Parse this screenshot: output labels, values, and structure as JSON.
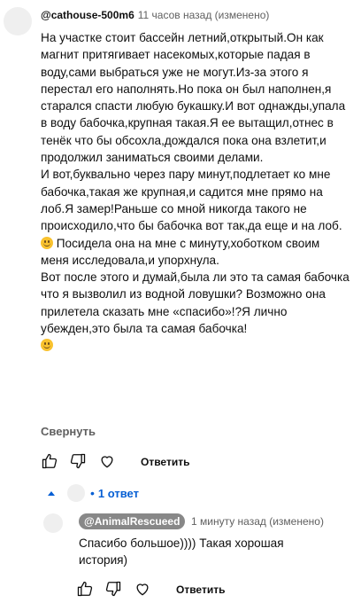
{
  "comment": {
    "author": "@cathouse-500m6",
    "meta": "11 часов назад (изменено)",
    "paragraphs": [
      "На участке стоит бассейн летний,открытый.Он как магнит притягивает насекомых,которые падая в воду,сами выбраться уже не могут.Из-за этого я перестал его наполнять.Но пока он был наполнен,я старался спасти любую букашку.И вот однажды,упала в воду бабочка,крупная такая.Я ее вытащил,отнес в тенёк что бы обсохла,дождался пока она взлетит,и продолжил заниматься своими делами.",
      "И вот,буквально через пару минут,подлетает ко мне бабочка,такая же крупная,и садится мне прямо на лоб.Я замер!Раньше со мной никогда такого не происходило,что бы бабочка вот так,да еще и на лоб.",
      " Посидела она на мне с минуту,хоботком своим меня исследовала,и упорхнула.",
      "Вот после этого и думай,была ли это та самая бабочка что я вызволил из водной ловушки? Возможно она прилетела сказать мне «спасибо»!?Я лично убежден,это была та самая бабочка!"
    ],
    "emoji": "smiling-face-emoji",
    "collapse_label": "Свернуть",
    "reply_label": "Ответить"
  },
  "replies_toggle": {
    "dot": "•",
    "count_label": "1 ответ"
  },
  "reply": {
    "author": "@AnimalRescueed",
    "meta": "1 минуту назад (изменено)",
    "text": "Спасибо большое)))) Такая хорошая история)",
    "reply_label": "Ответить"
  },
  "icons": {
    "like": "thumbs-up-icon",
    "dislike": "thumbs-down-icon",
    "heart": "heart-icon",
    "caret": "caret-up-icon"
  },
  "colors": {
    "link_blue": "#065fd4",
    "meta_gray": "#606060",
    "badge_gray": "#888888",
    "avatar_gray": "#efefef"
  }
}
